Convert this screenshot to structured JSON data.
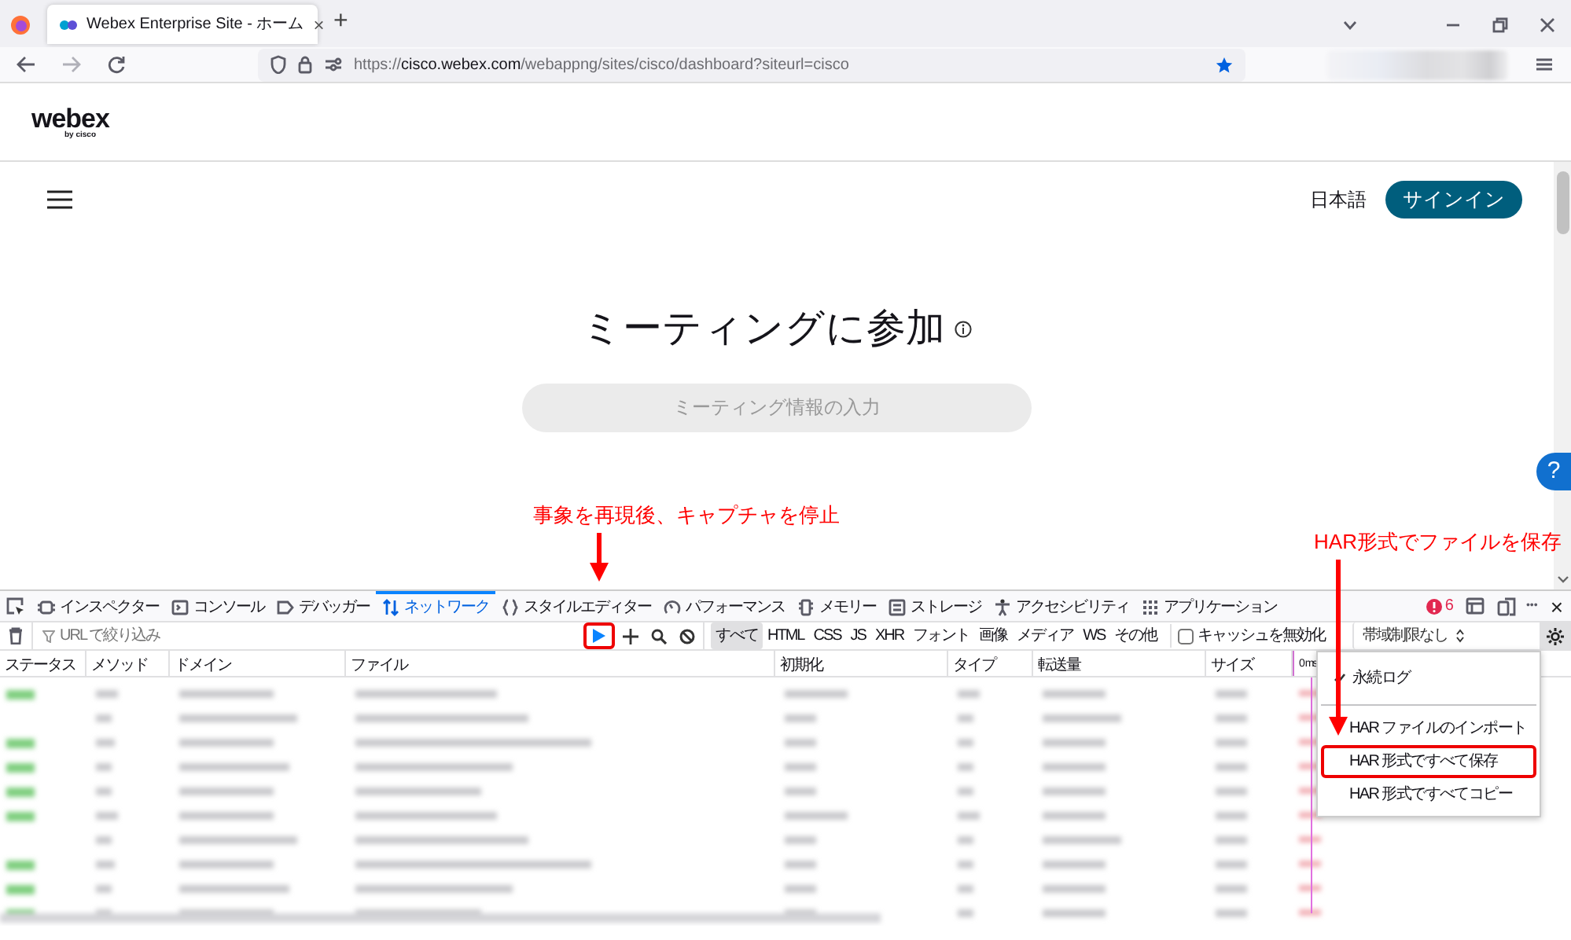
{
  "browser": {
    "tab": {
      "title": "Webex Enterprise Site - ホーム",
      "close": "×",
      "selected": true
    },
    "new_tab": "+",
    "url": "https://**cisco.webex.com**/webappng/sites/cisco/dashboard?siteurl=cisco",
    "bookmarked": true
  },
  "site": {
    "logo": "webex",
    "logo_sub": "by cisco",
    "language": "日本語",
    "sign_in": "サインイン",
    "title": "ミーティングに参加",
    "search": {
      "placeholder": "ミーティング情報の入力"
    },
    "help": "?"
  },
  "annotations": [
    {
      "text": "事象を再現後、キャプチャを停止"
    },
    {
      "text": "HAR形式でファイルを保存"
    }
  ],
  "devtools": {
    "tabs": [
      {
        "label": "インスペクター",
        "selected": false
      },
      {
        "label": "コンソール",
        "selected": false
      },
      {
        "label": "デバッガー",
        "selected": false
      },
      {
        "label": "ネットワーク",
        "selected": true
      },
      {
        "label": "スタイルエディター",
        "selected": false
      },
      {
        "label": "パフォーマンス",
        "selected": false
      },
      {
        "label": "メモリー",
        "selected": false
      },
      {
        "label": "ストレージ",
        "selected": false
      },
      {
        "label": "アクセシビリティ",
        "selected": false
      },
      {
        "label": "アプリケーション",
        "selected": false
      }
    ],
    "error_count": "6",
    "more": "•••",
    "close": "×",
    "filter": {
      "placeholder": "URL で絞り込み"
    },
    "record": {
      "highlighted": true
    },
    "type_filters": [
      {
        "label": "すべて",
        "selected": true
      },
      {
        "label": "HTML",
        "selected": false
      },
      {
        "label": "CSS",
        "selected": false
      },
      {
        "label": "JS",
        "selected": false
      },
      {
        "label": "XHR",
        "selected": false
      },
      {
        "label": "フォント",
        "selected": false
      },
      {
        "label": "画像",
        "selected": false
      },
      {
        "label": "メディア",
        "selected": false
      },
      {
        "label": "WS",
        "selected": false
      },
      {
        "label": "その他",
        "selected": false
      }
    ],
    "disable_cache": {
      "label": "キャッシュを無効化",
      "checked": false
    },
    "throttling": "帯域制限なし",
    "columns": [
      "ステータス",
      "メソッド",
      "ドメイン",
      "ファイル",
      "初期化",
      "タイプ",
      "転送量",
      "サイズ",
      "0 ms"
    ],
    "settings_menu": [
      {
        "label": "永続ログ",
        "kind": "check",
        "checked": true,
        "highlighted": false
      },
      {
        "label": "HAR ファイルのインポート",
        "kind": "action",
        "highlighted": false
      },
      {
        "label": "HAR 形式ですべて保存",
        "kind": "action",
        "highlighted": true
      },
      {
        "label": "HAR 形式ですべてコピー",
        "kind": "action",
        "highlighted": false
      }
    ]
  }
}
